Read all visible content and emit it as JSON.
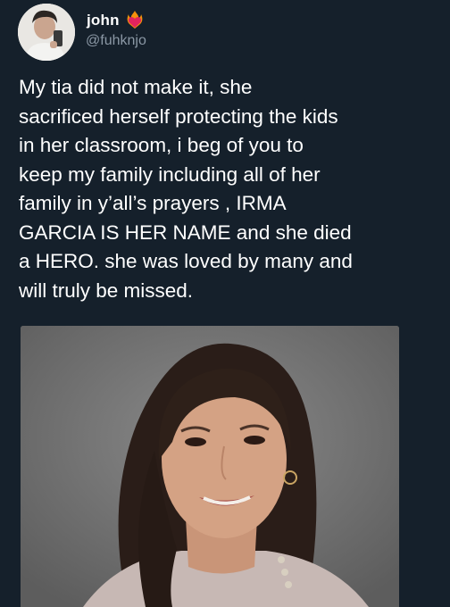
{
  "tweet": {
    "author": {
      "name": "john",
      "handle": "@fuhknjo",
      "name_icon": "heart-on-fire-icon",
      "avatar_icon": "profile-avatar"
    },
    "text": "My tia did not make it, she\nsacrificed herself protecting the kids\nin her classroom, i beg of you to\nkeep my family including all of her\nfamily in y’all’s prayers , IRMA\nGARCIA IS HER NAME and she died\na HERO. she was loved by many and\nwill truly be missed.",
    "media": {
      "type": "photo",
      "subject": "portrait-photo"
    }
  },
  "colors": {
    "background": "#15202b",
    "primary_text": "#ffffff",
    "secondary_text": "#8b98a5",
    "icon_red": "#e0245e",
    "icon_orange": "#f4900c"
  }
}
